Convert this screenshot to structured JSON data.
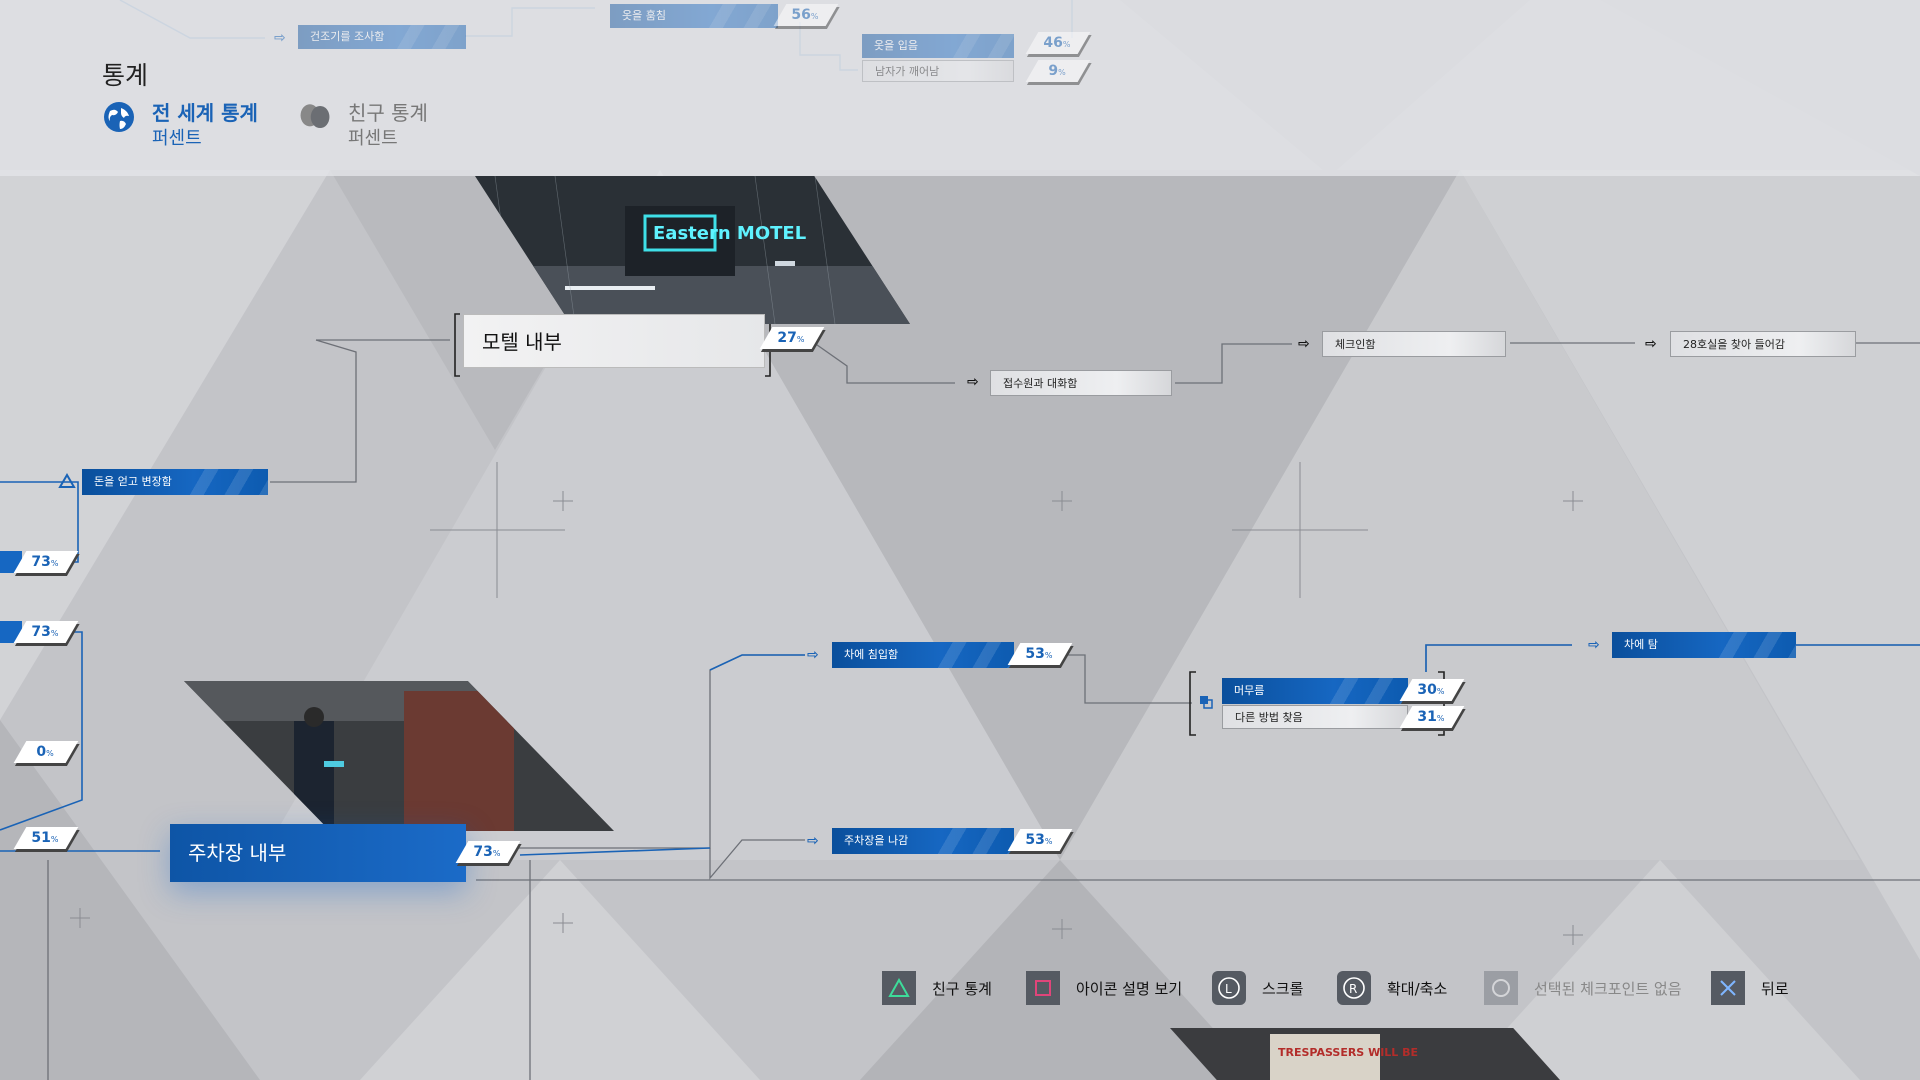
{
  "header": {
    "title": "통계",
    "tabs": [
      {
        "label": "전 세계 통계",
        "sub": "퍼센트",
        "active": true,
        "icon": "globe-icon"
      },
      {
        "label": "친구 통계",
        "sub": "퍼센트",
        "active": false,
        "icon": "friends-icon"
      }
    ]
  },
  "colors": {
    "accent": "#1a63b6",
    "node_blue": "#1667c2",
    "background": "#c3c4c8"
  },
  "top_faded": {
    "node_a": "건조기를 조사함",
    "node_b": "옷을 훔침",
    "node_b_pct": "56",
    "node_c": "옷을 입음",
    "node_c_pct": "46",
    "node_d": "남자가 깨어남",
    "node_d_pct": "9"
  },
  "motel": {
    "title": "모텔 내부",
    "pct": "27",
    "thumbnail_sign": "Eastern MOTEL",
    "node_reception": "접수원과 대화함",
    "node_checkin": "체크인함",
    "node_room": "28호실을 찾아 들어감"
  },
  "left": {
    "node_money": "돈을 얻고 변장함",
    "pct_1": "73",
    "pct_2": "73",
    "pct_3": "0",
    "pct_4": "51"
  },
  "parking": {
    "title": "주차장 내부",
    "pct": "73",
    "node_break_in": "차에 침입함",
    "node_break_in_pct": "53",
    "node_leave": "주차장을 나감",
    "node_leave_pct": "53",
    "node_stay": "머무름",
    "node_stay_pct": "30",
    "node_other": "다른 방법 찾음",
    "node_other_pct": "31",
    "node_get_in_car": "차에 탐"
  },
  "unit": "%",
  "bottom_thumb_sign": "TRESPASSERS WILL BE",
  "help_bar": [
    {
      "label": "친구 통계",
      "icon": "triangle-button-icon",
      "enabled": true
    },
    {
      "label": "아이콘 설명 보기",
      "icon": "square-button-icon",
      "enabled": true
    },
    {
      "label": "스크롤",
      "icon": "left-stick-icon",
      "enabled": true
    },
    {
      "label": "확대/축소",
      "icon": "right-stick-icon",
      "enabled": true
    },
    {
      "label": "선택된 체크포인트 없음",
      "icon": "circle-button-icon",
      "enabled": false
    },
    {
      "label": "뒤로",
      "icon": "cross-button-icon",
      "enabled": true
    }
  ]
}
